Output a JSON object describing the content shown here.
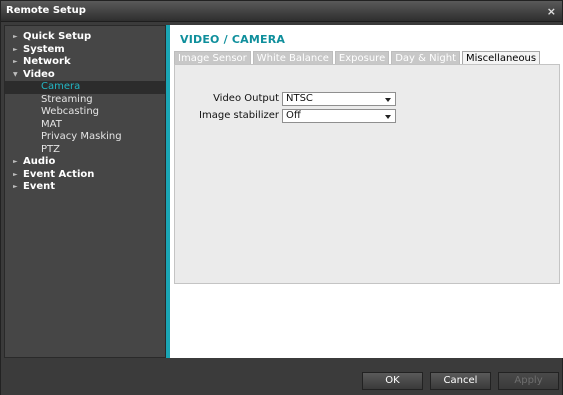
{
  "window": {
    "title": "Remote Setup",
    "close_glyph": "×"
  },
  "nav": [
    {
      "label": "Quick Setup",
      "level": 0,
      "arrow": "►"
    },
    {
      "label": "System",
      "level": 0,
      "arrow": "►"
    },
    {
      "label": "Network",
      "level": 0,
      "arrow": "►"
    },
    {
      "label": "Video",
      "level": 0,
      "arrow": "▼"
    },
    {
      "label": "Camera",
      "level": 1,
      "active": true
    },
    {
      "label": "Streaming",
      "level": 1
    },
    {
      "label": "Webcasting",
      "level": 1
    },
    {
      "label": "MAT",
      "level": 1
    },
    {
      "label": "Privacy Masking",
      "level": 1
    },
    {
      "label": "PTZ",
      "level": 1
    },
    {
      "label": "Audio",
      "level": 0,
      "arrow": "►"
    },
    {
      "label": "Event Action",
      "level": 0,
      "arrow": "►"
    },
    {
      "label": "Event",
      "level": 0,
      "arrow": "►"
    }
  ],
  "page": {
    "title": "VIDEO / CAMERA",
    "tabs": [
      "Image Sensor",
      "White Balance",
      "Exposure",
      "Day & Night",
      "Miscellaneous"
    ],
    "active_tab": 4
  },
  "form": {
    "video_output": {
      "label": "Video Output",
      "value": "NTSC"
    },
    "image_stabilizer": {
      "label": "Image stabilizer",
      "value": "Off"
    }
  },
  "footer": {
    "ok": "OK",
    "cancel": "Cancel",
    "apply": "Apply"
  },
  "colors": {
    "accent": "#1aa6b5",
    "title": "#0f8f9c",
    "active_nav": "#22b6c4"
  }
}
